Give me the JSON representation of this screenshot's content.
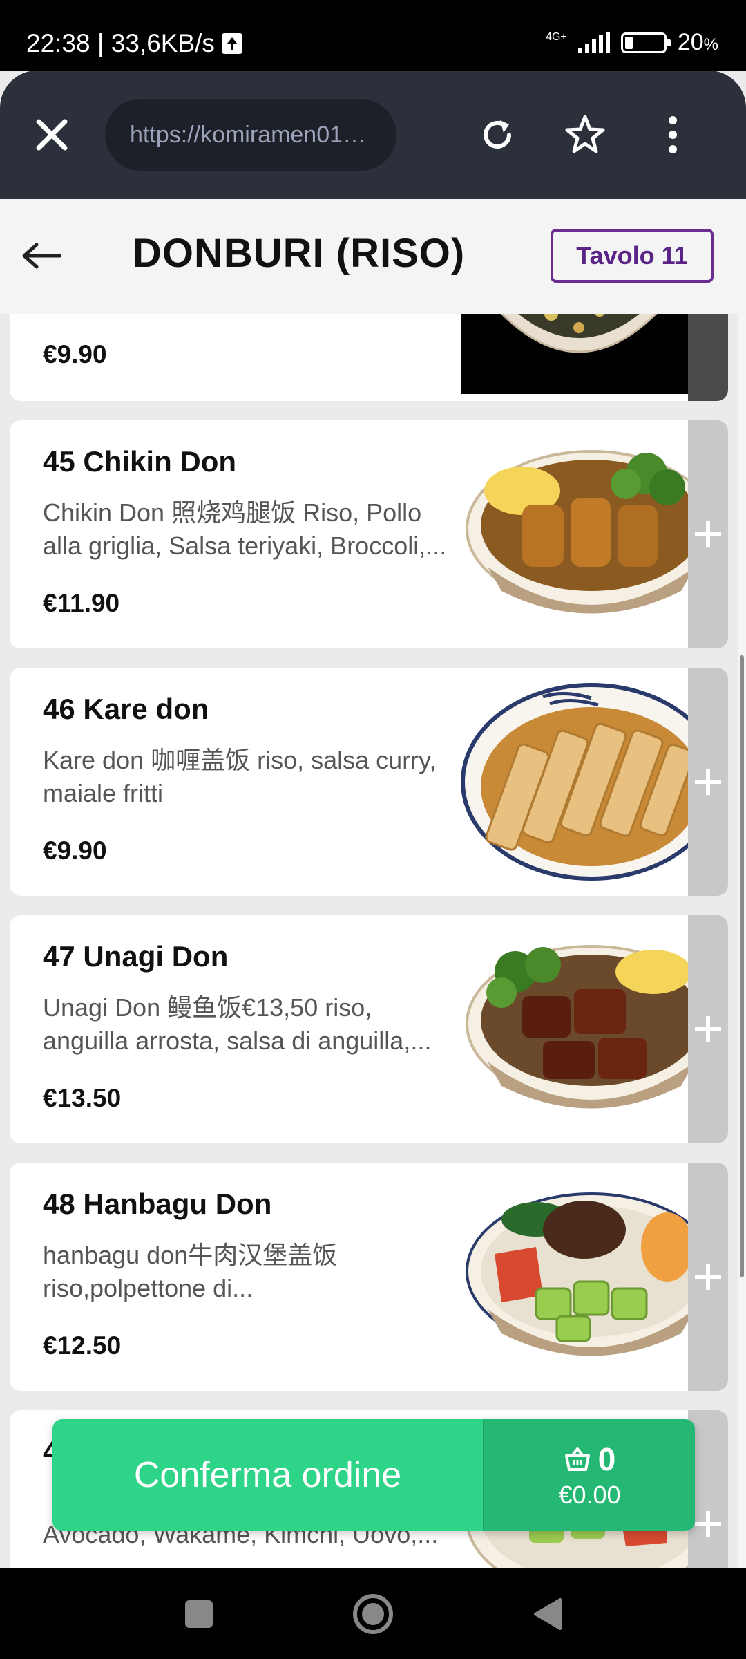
{
  "status_bar": {
    "time_speed": "22:38 | 33,6KB/s",
    "network": "4G+",
    "battery": "20",
    "battery_unit": "%",
    "battery_level": 0.2
  },
  "browser": {
    "url": "https://komiramen01…",
    "icons": [
      "close-icon",
      "refresh-icon",
      "star-icon",
      "more-vertical-icon"
    ]
  },
  "header": {
    "title": "DONBURI (RISO)",
    "table": "Tavolo 11",
    "accent_color": "#6a2c91"
  },
  "items": [
    {
      "name": "",
      "desc": "",
      "price": "€9.90"
    },
    {
      "name": "45 Chikin Don",
      "desc": "Chikin Don 照烧鸡腿饭 Riso, Pollo alla griglia, Salsa teriyaki, Broccoli,...",
      "price": "€11.90"
    },
    {
      "name": "46 Kare don",
      "desc": "Kare don 咖喱盖饭 riso, salsa curry, maiale fritti",
      "price": "€9.90"
    },
    {
      "name": "47 Unagi Don",
      "desc": "Unagi Don 鳗鱼饭€13,50 riso, anguilla arrosta, salsa di anguilla,...",
      "price": "€13.50"
    },
    {
      "name": "48 Hanbagu Don",
      "desc": "hanbagu don牛肉汉堡盖饭 riso,polpettone di...",
      "price": "€12.50"
    },
    {
      "name": "4",
      "desc": "Avocado, Wakame, Kimchi, Uovo,...",
      "price": ""
    }
  ],
  "order": {
    "confirm_label": "Conferma ordine",
    "cart_count": "0",
    "cart_total": "€0.00",
    "confirm_color": "#2ed487"
  }
}
